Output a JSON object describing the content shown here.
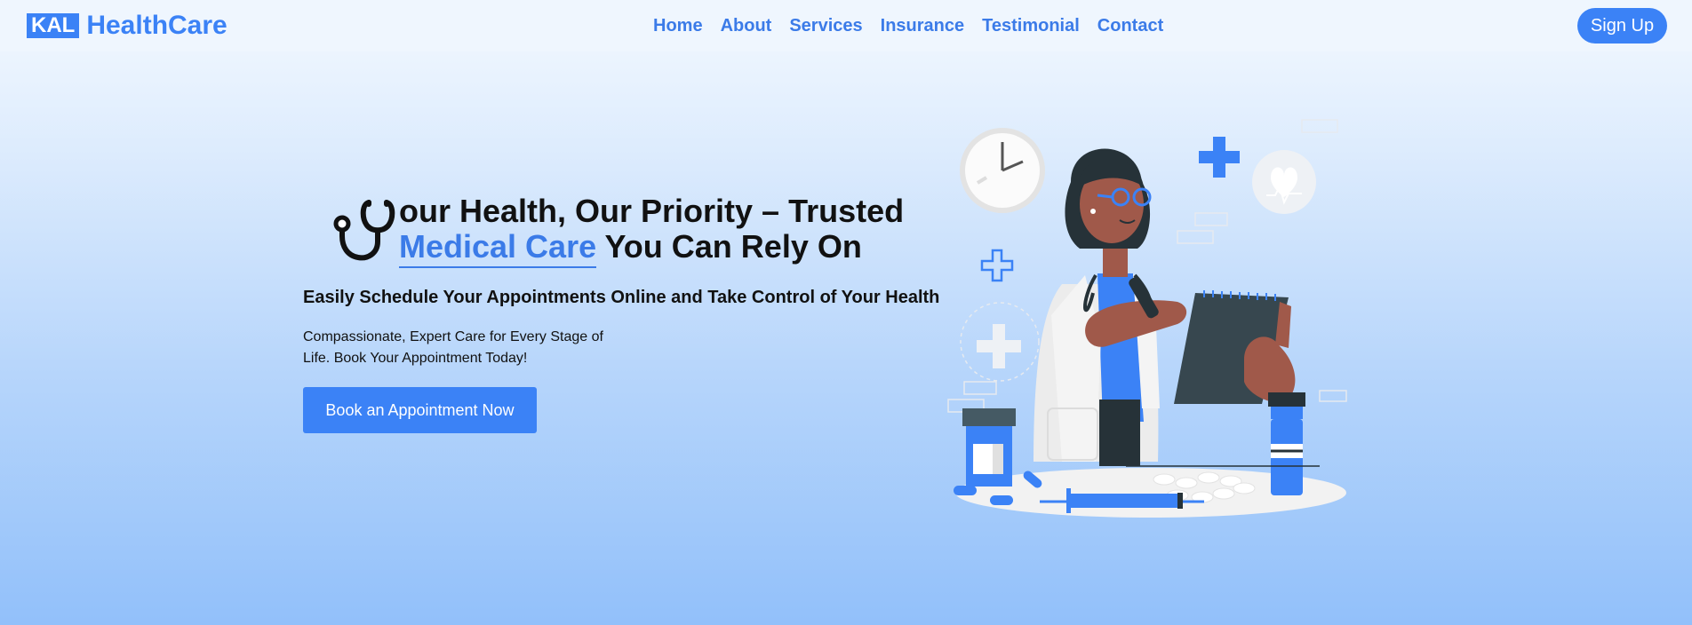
{
  "brand": {
    "badge": "KAL",
    "name": "HealthCare"
  },
  "nav": {
    "links": [
      "Home",
      "About",
      "Services",
      "Insurance",
      "Testimonial",
      "Contact"
    ],
    "signup_label": "Sign Up"
  },
  "hero": {
    "title_line1": "our Health, Our Priority – Trusted",
    "title_accent": "Medical Care",
    "title_line2_rest": " You Can Rely On",
    "subtitle": "Easily Schedule Your Appointments Online and Take Control of Your Health",
    "description": "Compassionate, Expert Care for Every Stage of Life. Book Your Appointment Today!",
    "cta_label": "Book an Appointment Now",
    "leading_icon": "stethoscope-icon",
    "illustration": "doctor-with-clipboard-illustration"
  },
  "colors": {
    "accent": "#3b82f6",
    "nav_link": "#3b7be8",
    "text": "#111111"
  }
}
